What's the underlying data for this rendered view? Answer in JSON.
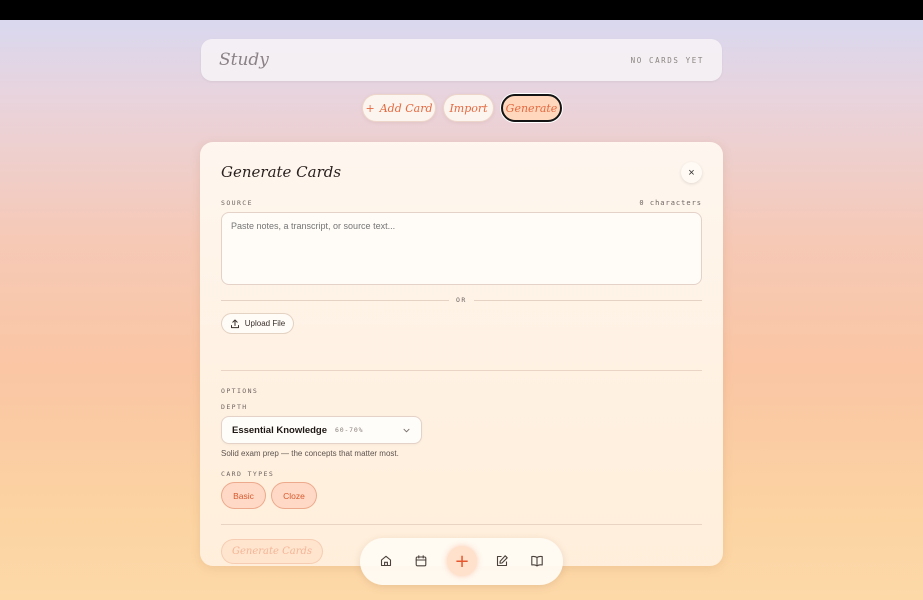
{
  "header": {
    "title": "Study",
    "status": "NO CARDS YET"
  },
  "actions": {
    "add_card": "Add Card",
    "add_icon": "+",
    "import": "Import",
    "generate": "Generate"
  },
  "panel": {
    "title": "Generate Cards",
    "close_icon": "×",
    "source_label": "SOURCE",
    "char_count": "0 characters",
    "source_placeholder": "Paste notes, a transcript, or source text...",
    "or_text": "OR",
    "upload_label": "Upload File",
    "options_label": "OPTIONS",
    "depth_label": "DEPTH",
    "depth_value": "Essential Knowledge",
    "depth_range": "60-70%",
    "depth_description": "Solid exam prep — the concepts that matter most.",
    "card_types_label": "CARD TYPES",
    "card_types": [
      "Basic",
      "Cloze"
    ],
    "submit_label": "Generate Cards"
  },
  "bottom_nav": {
    "items": [
      "home-icon",
      "calendar-icon",
      "add-icon",
      "edit-icon",
      "book-icon"
    ],
    "add_symbol": "+"
  },
  "colors": {
    "accent": "#e46a40",
    "chip_bg": "#ffd9c6"
  }
}
